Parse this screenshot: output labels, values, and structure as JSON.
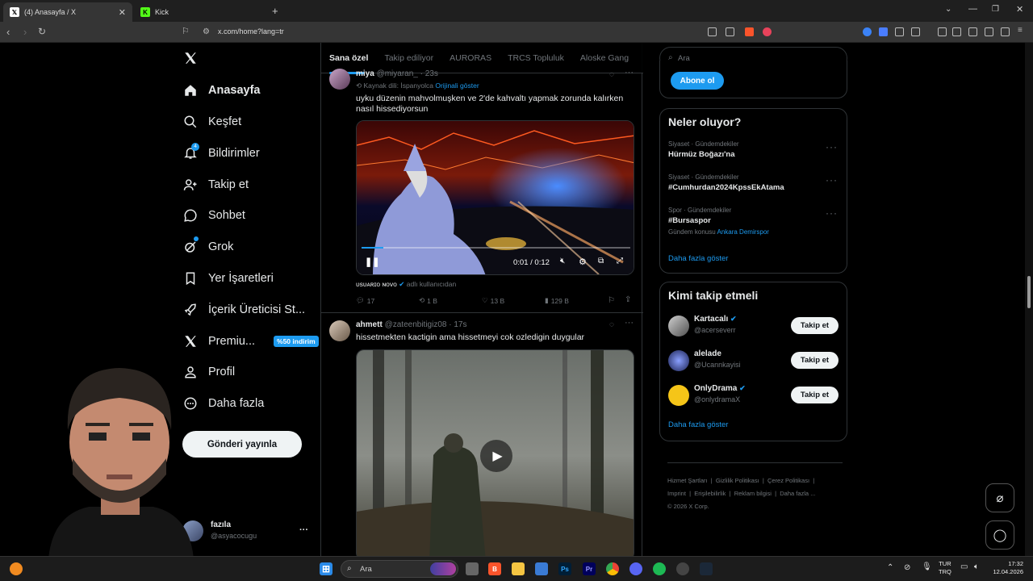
{
  "browser": {
    "tabs": [
      {
        "label": "(4) Anasayfa / X",
        "icon": "x-logo-icon",
        "active": true
      },
      {
        "label": "Kick",
        "icon": "kick-icon",
        "active": false
      }
    ],
    "url": "x.com/home?lang=tr"
  },
  "nav": {
    "items": [
      {
        "label": "Anasayfa",
        "icon": "home-icon"
      },
      {
        "label": "Keşfet",
        "icon": "search-icon"
      },
      {
        "label": "Bildirimler",
        "icon": "bell-icon",
        "badge": "4"
      },
      {
        "label": "Takip et",
        "icon": "add-user-icon"
      },
      {
        "label": "Sohbet",
        "icon": "chat-icon"
      },
      {
        "label": "Grok",
        "icon": "grok-icon"
      },
      {
        "label": "Yer İşaretleri",
        "icon": "bookmark-icon"
      },
      {
        "label": "İçerik Üreticisi St...",
        "icon": "rocket-icon"
      },
      {
        "label": "Premiu...",
        "icon": "x-logo-icon",
        "promo": "%50 indirim"
      },
      {
        "label": "Profil",
        "icon": "person-icon"
      },
      {
        "label": "Daha fazla",
        "icon": "more-circle-icon"
      }
    ],
    "post_button": "Gönderi yayınla",
    "account": {
      "name": "fazıla",
      "handle": "@asyacocugu",
      "more": "···"
    }
  },
  "timeline": {
    "tabs": [
      "Sana özel",
      "Takip ediliyor",
      "AURORAS",
      "TRCS Topluluk",
      "Aloske Gang"
    ],
    "tweet1": {
      "name": "miya",
      "handle": "@miyaran_",
      "time": "· 23s",
      "source_lang": "Kaynak dili: İspanyolca",
      "show_original": "Orijinali göster",
      "text": "uyku düzenin mahvolmuşken ve 2'de kahvaltı yapmak zorunda kalırken nasıl hissediyorsun",
      "video_time": "0:01 / 0:12",
      "video_progress": 0.08,
      "credit_name": "ᴜsᴜᴀʀɪᴏ ɴᴏᴠᴏ",
      "credit_suffix": "adlı kullanıcıdan",
      "replies": "17",
      "reposts": "1 B",
      "likes": "13 B",
      "views": "129 B"
    },
    "tweet2": {
      "name": "ahmett",
      "handle": "@zateenbitigiz08",
      "time": "· 17s",
      "text": "hissetmekten kactigin ama hissetmeyi cok ozledigin duygular"
    }
  },
  "sidebar": {
    "search_placeholder": "Ara",
    "subscribe_button": "Abone ol",
    "trends_title": "Neler oluyor?",
    "trends": [
      {
        "category": "Siyaset · Gündemdekiler",
        "name": "Hürmüz Boğazı'na"
      },
      {
        "category": "Siyaset · Gündemdekiler",
        "name": "#Cumhurdan2024KpssEkAtama"
      },
      {
        "category": "Spor · Gündemdekiler",
        "name": "#Bursaspor",
        "related_prefix": "Gündem konusu",
        "related": "Ankara Demirspor"
      }
    ],
    "trends_more": "Daha fazla göster",
    "who_to_follow_title": "Kimi takip etmeli",
    "follow_suggestions": [
      {
        "name": "Kartacalı",
        "handle": "@acerseverr",
        "verified": true,
        "button": "Takip et"
      },
      {
        "name": "alelade",
        "handle": "@Ucannkayisi",
        "verified": false,
        "button": "Takip et"
      },
      {
        "name": "OnlyDrama",
        "handle": "@onlydramaX",
        "verified": true,
        "button": "Takip et"
      }
    ],
    "follow_more": "Daha fazla göster",
    "footer_links": [
      "Hizmet Şartları",
      "Gizlilik Politikası",
      "Çerez Politikası",
      "Imprint",
      "Erişilebilirlik",
      "Reklam bilgisi",
      "Daha fazla ..."
    ],
    "copyright": "© 2026 X Corp."
  },
  "taskbar": {
    "search_placeholder": "Ara",
    "lang_top": "TUR",
    "lang_bottom": "TRQ",
    "time": "17:32",
    "date": "12.04.2026"
  },
  "colors": {
    "accent": "#1d9bf0",
    "background": "#000000",
    "border": "#2f3336",
    "muted": "#71767b"
  }
}
